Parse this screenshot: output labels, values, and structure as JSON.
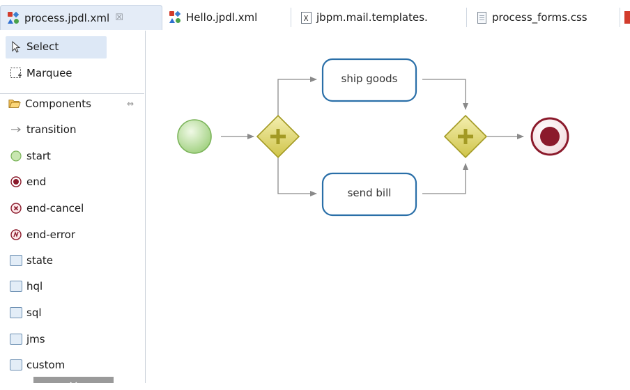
{
  "tabs": [
    {
      "label": "process.jpdl.xml",
      "icon": "jpdl-file-icon",
      "close": "☒",
      "active": true
    },
    {
      "label": "Hello.jpdl.xml",
      "icon": "jpdl-file-icon",
      "active": false
    },
    {
      "label": "jbpm.mail.templates.",
      "icon": "xml-file-icon",
      "active": false
    },
    {
      "label": "process_forms.css",
      "icon": "css-file-icon",
      "active": false
    }
  ],
  "palette": {
    "select": "Select",
    "marquee": "Marquee",
    "components": "Components",
    "collapse_glyph": "⇔",
    "items": [
      "transition",
      "start",
      "end",
      "end-cancel",
      "end-error",
      "state",
      "hql",
      "sql",
      "jms",
      "custom"
    ]
  },
  "diagram": {
    "tasks": [
      "ship goods",
      "send bill"
    ],
    "colors": {
      "task_stroke": "#2a6fa8",
      "gateway": "#cfc449",
      "start": "#9fd07e",
      "end": "#8b1a2b",
      "edge": "#8a8a8a"
    }
  }
}
